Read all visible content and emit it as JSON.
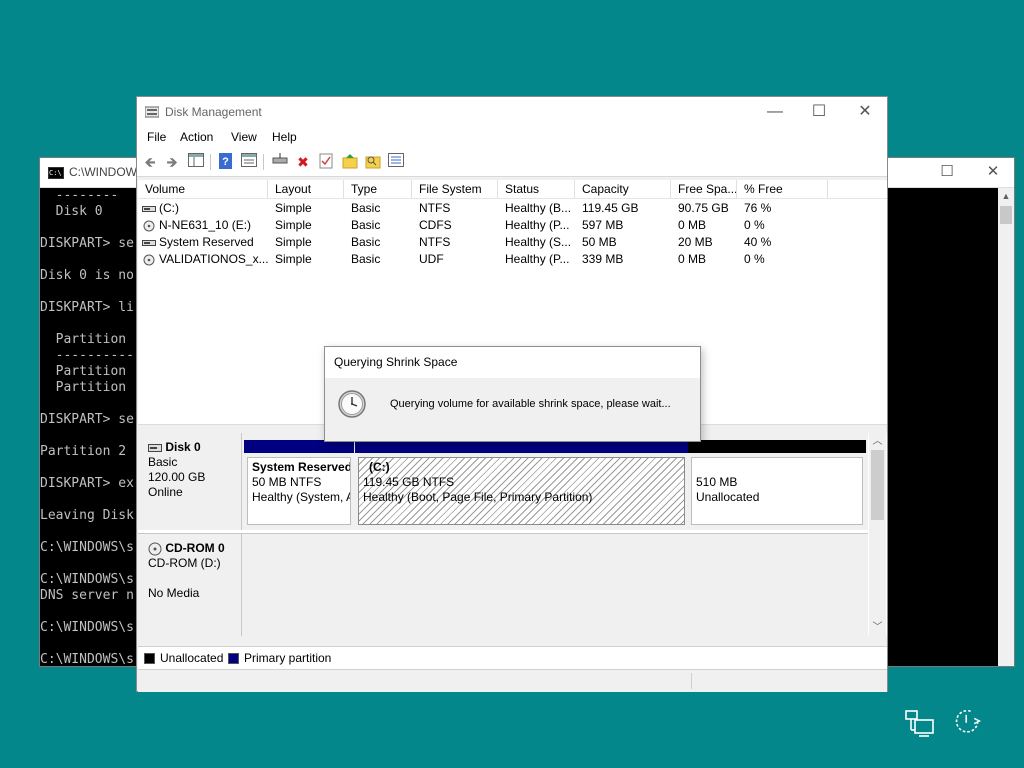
{
  "cmd": {
    "title": "C:\\WINDOWS\\s",
    "icon_text": "C:\\",
    "lines": [
      "  --------",
      "  Disk 0",
      "",
      "DISKPART> se",
      "",
      "Disk 0 is no",
      "",
      "DISKPART> li",
      "",
      "  Partition",
      "  ----------",
      "  Partition",
      "  Partition",
      "",
      "DISKPART> se",
      "",
      "Partition 2",
      "",
      "DISKPART> ex",
      "",
      "Leaving Disk",
      "",
      "C:\\WINDOWS\\s",
      "",
      "C:\\WINDOWS\\s",
      "DNS server n",
      "",
      "C:\\WINDOWS\\s",
      "",
      "C:\\WINDOWS\\s"
    ]
  },
  "window": {
    "title": "Disk Management",
    "minimize": "—",
    "maximize": "☐",
    "close": "✕"
  },
  "menu": [
    "File",
    "Action",
    "View",
    "Help"
  ],
  "toolbar_icons": [
    "back-arrow-icon",
    "forward-arrow-icon",
    "console-tree-icon",
    "help-icon",
    "properties-icon",
    "connect-drive-icon",
    "delete-icon",
    "check-icon",
    "folder-up-icon",
    "search-folder-icon",
    "settings-list-icon"
  ],
  "volume_list": {
    "columns": [
      "Volume",
      "Layout",
      "Type",
      "File System",
      "Status",
      "Capacity",
      "Free Spa...",
      "% Free"
    ],
    "rows": [
      {
        "icon": "drive-icon",
        "volume": "(C:)",
        "layout": "Simple",
        "type": "Basic",
        "fs": "NTFS",
        "status": "Healthy (B...",
        "capacity": "119.45 GB",
        "free": "90.75 GB",
        "pct": "76 %"
      },
      {
        "icon": "cd-drive-icon",
        "volume": "N-NE631_10 (E:)",
        "layout": "Simple",
        "type": "Basic",
        "fs": "CDFS",
        "status": "Healthy (P...",
        "capacity": "597 MB",
        "free": "0 MB",
        "pct": "0 %"
      },
      {
        "icon": "drive-icon",
        "volume": "System Reserved",
        "layout": "Simple",
        "type": "Basic",
        "fs": "NTFS",
        "status": "Healthy (S...",
        "capacity": "50 MB",
        "free": "20 MB",
        "pct": "40 %"
      },
      {
        "icon": "cd-drive-icon",
        "volume": "VALIDATIONOS_x...",
        "layout": "Simple",
        "type": "Basic",
        "fs": "UDF",
        "status": "Healthy (P...",
        "capacity": "339 MB",
        "free": "0 MB",
        "pct": "0 %"
      }
    ]
  },
  "disks": {
    "disk0": {
      "name": "Disk 0",
      "type": "Basic",
      "size": "120.00 GB",
      "state": "Online",
      "partitions": [
        {
          "name": "System Reserved",
          "size": "50 MB NTFS",
          "status": "Healthy (System, A",
          "color": "#000080"
        },
        {
          "name": "(C:)",
          "size": "119.45 GB NTFS",
          "status": "Healthy (Boot, Page File, Primary Partition)",
          "color": "#000080"
        },
        {
          "name": "",
          "size": "510 MB",
          "status": "Unallocated",
          "color": "#000000"
        }
      ]
    },
    "cdrom0": {
      "name": "CD-ROM 0",
      "drive": "CD-ROM (D:)",
      "media": "No Media"
    }
  },
  "legend": [
    {
      "label": "Unallocated",
      "color": "#000000"
    },
    {
      "label": "Primary partition",
      "color": "#000080"
    }
  ],
  "dialog": {
    "title": "Querying Shrink Space",
    "message": "Querying volume for available shrink space, please wait..."
  }
}
